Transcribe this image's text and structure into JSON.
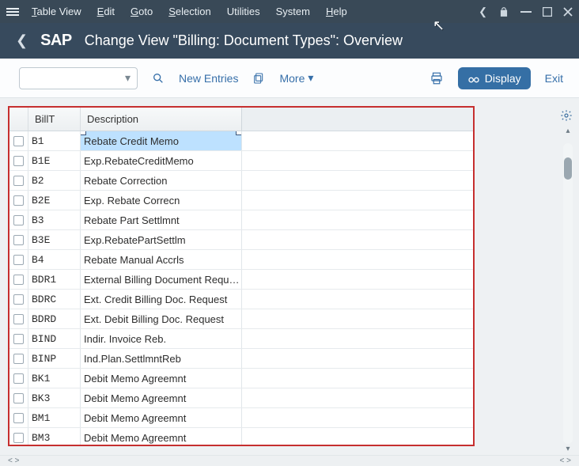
{
  "menubar": {
    "items": [
      "Table View",
      "Edit",
      "Goto",
      "Selection",
      "Utilities",
      "System",
      "Help"
    ],
    "underline_idx": [
      0,
      0,
      0,
      0,
      null,
      null,
      0
    ]
  },
  "header": {
    "logo": "SAP",
    "title": "Change View \"Billing: Document Types\": Overview"
  },
  "toolbar": {
    "combo_value": "",
    "new_entries_label": "New Entries",
    "more_label": "More",
    "display_label": "Display",
    "exit_label": "Exit"
  },
  "table": {
    "columns": {
      "billt": "BillT",
      "desc": "Description"
    },
    "rows": [
      {
        "billt": "B1",
        "desc": "Rebate Credit Memo",
        "selected_cell": true
      },
      {
        "billt": "B1E",
        "desc": "Exp.RebateCreditMemo"
      },
      {
        "billt": "B2",
        "desc": "Rebate Correction"
      },
      {
        "billt": "B2E",
        "desc": "Exp. Rebate Correcn"
      },
      {
        "billt": "B3",
        "desc": "Rebate Part Settlmnt"
      },
      {
        "billt": "B3E",
        "desc": "Exp.RebatePartSettlm"
      },
      {
        "billt": "B4",
        "desc": "Rebate Manual Accrls"
      },
      {
        "billt": "BDR1",
        "desc": "External Billing Document Requ…"
      },
      {
        "billt": "BDRC",
        "desc": "Ext. Credit Billing Doc. Request"
      },
      {
        "billt": "BDRD",
        "desc": "Ext. Debit Billing Doc. Request"
      },
      {
        "billt": "BIND",
        "desc": "Indir. Invoice Reb."
      },
      {
        "billt": "BINP",
        "desc": "Ind.Plan.SettlmntReb"
      },
      {
        "billt": "BK1",
        "desc": "Debit Memo Agreemnt"
      },
      {
        "billt": "BK3",
        "desc": "Debit Memo Agreemnt"
      },
      {
        "billt": "BM1",
        "desc": "Debit Memo Agreemnt"
      },
      {
        "billt": "BM3",
        "desc": "Debit Memo Agreemnt"
      }
    ]
  }
}
